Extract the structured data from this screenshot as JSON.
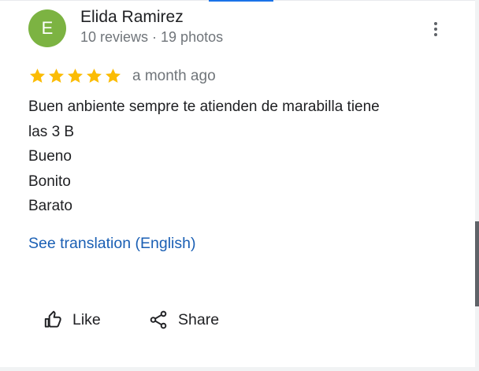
{
  "review": {
    "author": {
      "initial": "E",
      "name": "Elida Ramirez",
      "meta": "10 reviews · 19 photos",
      "avatar_color": "#7cb342"
    },
    "menu_icon": "more-vert-icon",
    "rating": {
      "stars": 5,
      "max": 5,
      "star_color": "#fbbc04"
    },
    "time_ago": "a month ago",
    "text_lines": [
      "Buen anbiente sempre te atienden de marabilla  tiene",
      "las 3 B",
      "Bueno",
      "Bonito",
      "Barato"
    ],
    "translate_label": "See translation (English)",
    "actions": {
      "like_label": "Like",
      "like_icon": "thumbs-up-icon",
      "share_label": "Share",
      "share_icon": "share-icon"
    }
  },
  "colors": {
    "link": "#1a5fb4",
    "accent": "#1a73e8",
    "secondary_text": "#70757a"
  }
}
